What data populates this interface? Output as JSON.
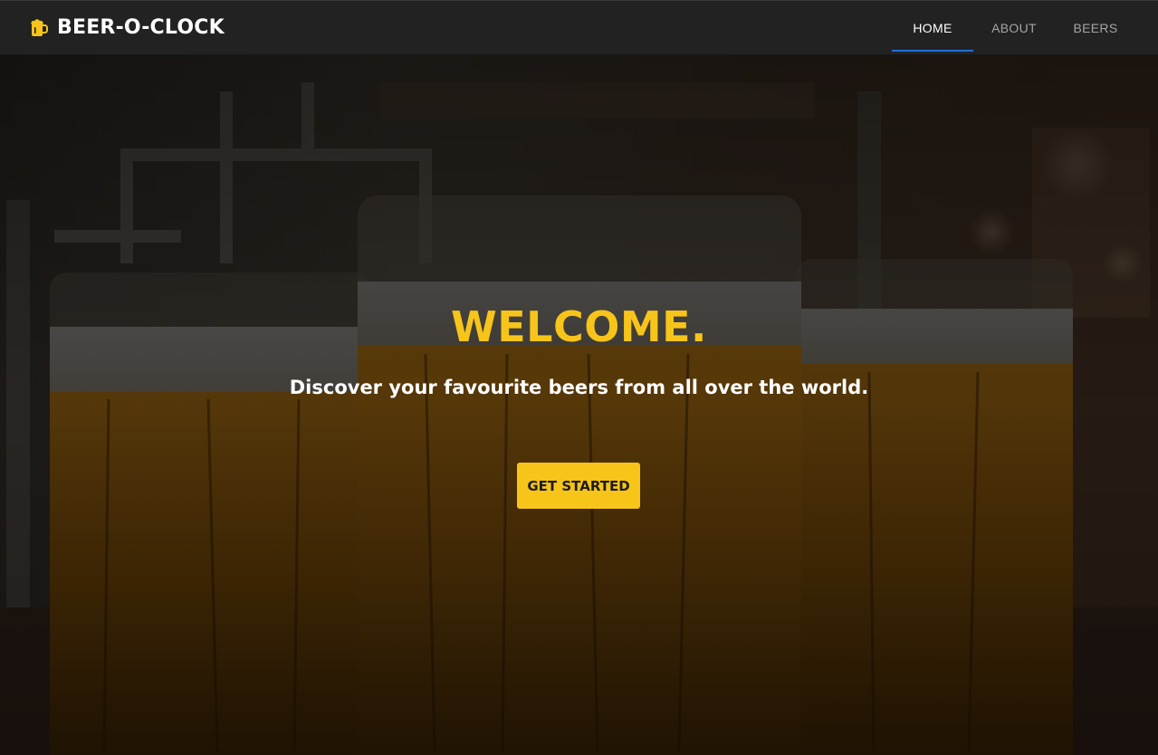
{
  "brand": {
    "icon": "beer-mug-icon",
    "name": "BEER-O-CLOCK"
  },
  "nav": {
    "items": [
      {
        "label": "HOME",
        "active": true
      },
      {
        "label": "ABOUT",
        "active": false
      },
      {
        "label": "BEERS",
        "active": false
      }
    ]
  },
  "hero": {
    "background": "beer-glasses-photo",
    "title": "WELCOME.",
    "subtitle": "Discover your favourite beers from all over the world.",
    "cta_label": "GET STARTED"
  },
  "colors": {
    "accent": "#f7c41a",
    "navbar": "#222222",
    "active_underline": "#1e6fd9",
    "text_primary": "#ffffff",
    "text_muted": "#a5a5a5"
  }
}
